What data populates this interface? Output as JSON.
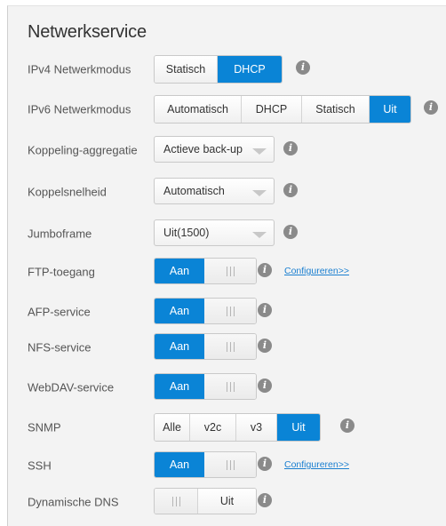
{
  "section_title": "Netwerkservice",
  "rows": {
    "ipv4": {
      "label": "IPv4 Netwerkmodus",
      "options": [
        "Statisch",
        "DHCP"
      ],
      "active": "DHCP"
    },
    "ipv6": {
      "label": "IPv6 Netwerkmodus",
      "options": [
        "Automatisch",
        "DHCP",
        "Statisch",
        "Uit"
      ],
      "active": "Uit"
    },
    "aggregation": {
      "label": "Koppeling-aggregatie",
      "value": "Actieve back-up"
    },
    "link_speed": {
      "label": "Koppelsnelheid",
      "value": "Automatisch"
    },
    "jumbo": {
      "label": "Jumboframe",
      "value": "Uit(1500)"
    },
    "ftp": {
      "label": "FTP-toegang",
      "state": "Aan",
      "link": "Configureren>>"
    },
    "afp": {
      "label": "AFP-service",
      "state": "Aan"
    },
    "nfs": {
      "label": "NFS-service",
      "state": "Aan"
    },
    "webdav": {
      "label": "WebDAV-service",
      "state": "Aan"
    },
    "snmp": {
      "label": "SNMP",
      "options": [
        "Alle",
        "v2c",
        "v3",
        "Uit"
      ],
      "active": "Uit"
    },
    "ssh": {
      "label": "SSH",
      "state": "Aan",
      "link": "Configureren>>"
    },
    "ddns": {
      "label": "Dynamische DNS",
      "state": "Uit"
    }
  },
  "info_icon_glyph": "i",
  "colors": {
    "accent": "#0a84d6",
    "link": "#1a7fd0",
    "info_icon": "#8a8a8a"
  }
}
